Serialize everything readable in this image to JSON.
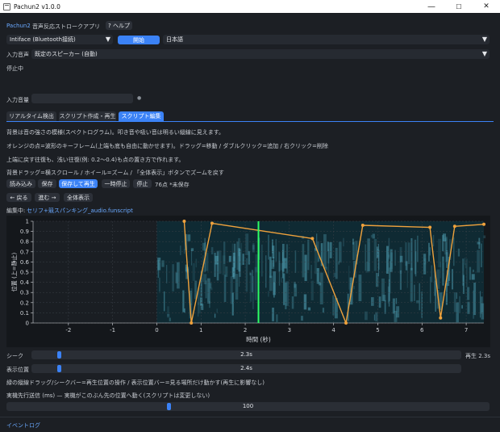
{
  "window": {
    "title": "Pachun2 v1.0.0",
    "minimize": "—",
    "maximize": "☐",
    "close": "✕"
  },
  "header": {
    "app_name": "Pachun2",
    "subtitle": "音声反応ストロークアプリ",
    "help_label": "? ヘルプ"
  },
  "device": {
    "selected": "Intiface (Bluetooth接続)",
    "open_label": "開始",
    "language": "日本語"
  },
  "input_audio": {
    "label": "入力音声",
    "selected": "既定のスピーカー (自動)"
  },
  "status": "停止中",
  "volume": {
    "label": "入力音量",
    "indicator": "●"
  },
  "tabs": [
    {
      "label": "リアルタイム検出"
    },
    {
      "label": "スクリプト作成・再生"
    },
    {
      "label": "スクリプト編集"
    }
  ],
  "help_lines": [
    "背景は音の強さの模様(スペクトログラム)。叩き音や吸い音は明るい縦線に見えます。",
    "オレンジの点=波形のキーフレーム(上端も底も自由に動かせます)。ドラッグ=移動 / ダブルクリック=追加 / 右クリック=削除",
    "上端に戻す往復も、浅い往復(例: 0.2〜0.4)も点の置き方で作れます。",
    "背景ドラッグ=横スクロール / ホイール=ズーム / 「全体表示」ボタンでズームを戻す"
  ],
  "toolbar": {
    "load": "読み込み",
    "save": "保存",
    "save_play": "保存して再生",
    "pause": "一時停止",
    "stop": "停止",
    "point_count": "76点 *未保存",
    "back": "← 戻る",
    "forward": "進む →",
    "fit_all": "全体表示"
  },
  "editing": {
    "label": "編集中:",
    "file": "セリフ+競スパンキング_audio.funscript"
  },
  "chart_data": {
    "type": "line",
    "xlabel": "時間 (秒)",
    "ylabel": "位置 (上=静止)",
    "xlim": [
      -2.8,
      7.4
    ],
    "ylim": [
      0,
      1
    ],
    "xticks": [
      -2,
      -1,
      0,
      1,
      2,
      3,
      4,
      5,
      6,
      7
    ],
    "yticks": [
      0,
      0.1,
      0.2,
      0.3,
      0.4,
      0.5,
      0.6,
      0.7,
      0.8,
      0.9,
      1
    ],
    "grid": true,
    "playhead": 2.3,
    "spectrogram_start": 0,
    "series": [
      {
        "color": "#f0a23c",
        "x": [
          0.62,
          0.78,
          1.25,
          3.52,
          4.28,
          4.66,
          6.18,
          6.42,
          6.74,
          7.4
        ],
        "y": [
          1.0,
          0.0,
          0.98,
          0.83,
          0.0,
          0.96,
          0.94,
          0.05,
          0.95,
          0.97
        ]
      }
    ],
    "colors": {
      "line": "#f0a23c",
      "playhead": "#2dff66",
      "axis": "#cfd3d8",
      "grid": "#3a4048"
    }
  },
  "seek": {
    "label": "シーク",
    "value_text": "2.3s",
    "total_text": "再生 2.3s",
    "fraction": 0.06
  },
  "view_pos": {
    "label": "表示位置",
    "value_text": "2.4s",
    "fraction": 0.06
  },
  "slider_help": "緑の縦線ドラッグ/シークバー=再生位置の操作 / 表示位置バー=見る場所だけ動かす(再生に影響なし)",
  "latency": {
    "label": "実機先行送信 (ms) — 実機がこのぶん先の位置へ動く(スクリプトは変更しない)",
    "value_text": "100",
    "fraction": 0.335
  },
  "event_log": "イベントログ"
}
